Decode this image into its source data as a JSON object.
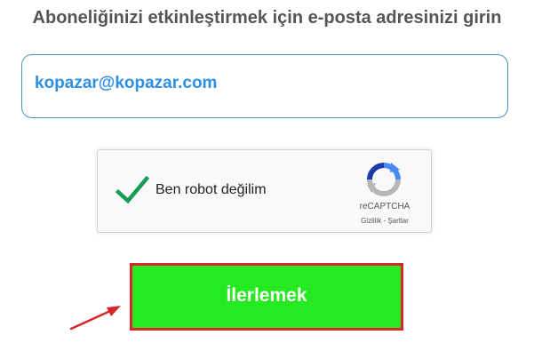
{
  "heading": "Aboneliğinizi etkinleştirmek için e-posta adresinizi girin",
  "email": {
    "value": "kopazar@kopazar.com"
  },
  "captcha": {
    "label": "Ben robot değilim",
    "checked": true,
    "brand": "reCAPTCHA",
    "privacy": "Gizlilik",
    "separator": "-",
    "terms": "Şartlar"
  },
  "submit": {
    "label": "İlerlemek"
  },
  "colors": {
    "heading": "#555555",
    "email_text": "#2e8fe6",
    "email_border": "#4a90c8",
    "button_fill": "#26ea21",
    "button_border": "#d8262a",
    "check": "#159d55",
    "arrow": "#d8262a"
  },
  "icons": {
    "check": "check-icon",
    "recaptcha": "recaptcha-logo-icon",
    "pointer": "arrow-icon"
  }
}
